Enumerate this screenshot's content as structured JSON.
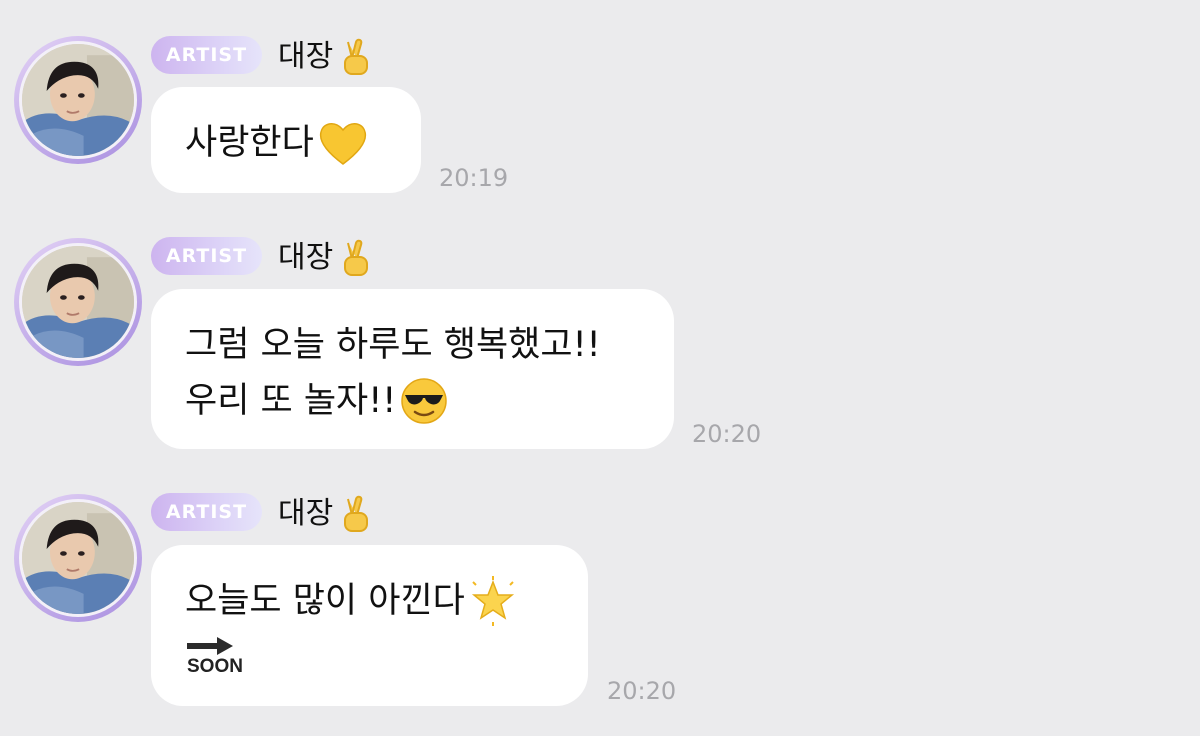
{
  "sender": {
    "badge": "ARTIST",
    "name": "대장",
    "name_emoji_icon": "victory-hand-icon"
  },
  "messages": [
    {
      "lines": [
        "사랑한다"
      ],
      "emojis": [
        "yellow-heart-icon"
      ],
      "time": "20:19"
    },
    {
      "lines": [
        "그럼 오늘 하루도 행복했고!!",
        "우리 또 놀자!!"
      ],
      "emojis": [
        "sunglasses-face-icon"
      ],
      "time": "20:20"
    },
    {
      "lines": [
        "오늘도 많이 아낀다"
      ],
      "emojis": [
        "glowing-star-icon"
      ],
      "extra": "SOON",
      "extra_icon": "soon-arrow-icon",
      "time": "20:20"
    }
  ],
  "colors": {
    "background": "#ebebed",
    "bubble": "#ffffff",
    "badge": "#cdb4ef",
    "time": "#a7a7ab"
  }
}
